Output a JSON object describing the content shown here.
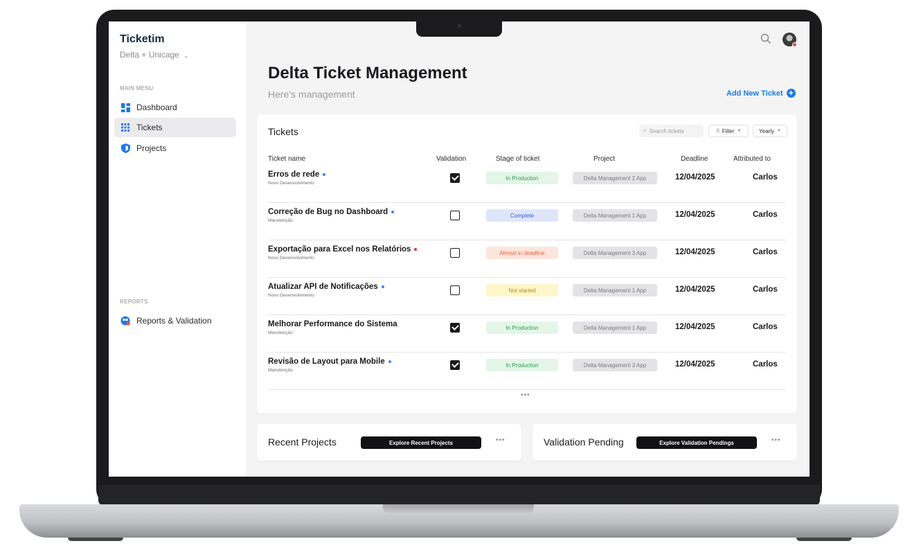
{
  "sidebar": {
    "brand": "Ticketim",
    "workspace": "Delta + Unicage",
    "main_menu_label": "MAIN MENU",
    "items": [
      {
        "label": "Dashboard",
        "icon": "dashboard-icon"
      },
      {
        "label": "Tickets",
        "icon": "grid-icon",
        "active": true
      },
      {
        "label": "Projects",
        "icon": "shield-icon"
      }
    ],
    "reports_label": "REPORTS",
    "reports_items": [
      {
        "label": "Reports & Validation",
        "icon": "reports-icon"
      }
    ]
  },
  "header": {
    "title_bold": "Delta",
    "title_rest": " Ticket Management",
    "subtitle": "Here's management",
    "add_ticket": "Add New Ticket"
  },
  "tickets": {
    "title": "Tickets",
    "search_placeholder": "Search tickets",
    "filter_label": "Filter",
    "period_label": "Yearly",
    "columns": [
      "Ticket name",
      "Validation",
      "Stage of ticket",
      "Project",
      "Deadline",
      "Attributed to"
    ],
    "rows": [
      {
        "name": "Erros de rede",
        "category": "Novo Desenvolvimento",
        "dot_color": "#3b82f6",
        "validated": true,
        "stage": "In Production",
        "project": "Delta Management 2 App",
        "deadline": "12/04/2025",
        "owner": "Carlos"
      },
      {
        "name": "Correção de Bug no Dashboard",
        "category": "Manutenção",
        "dot_color": "#3b82f6",
        "validated": false,
        "stage": "Complete",
        "project": "Delta Management 1 App",
        "deadline": "12/04/2025",
        "owner": "Carlos"
      },
      {
        "name": "Exportação para Excel nos Relatórios",
        "category": "Novo Desenvolvimento",
        "dot_color": "#ef2b2b",
        "validated": false,
        "stage": "Almost in deadline",
        "project": "Delta Management 3 App",
        "deadline": "12/04/2025",
        "owner": "Carlos"
      },
      {
        "name": "Atualizar API de Notificações",
        "category": "Novo Desenvolvimento",
        "dot_color": "#3b82f6",
        "validated": false,
        "stage": "Not started",
        "project": "Delta Management 1 App",
        "deadline": "12/04/2025",
        "owner": "Carlos"
      },
      {
        "name": "Melhorar Performance do Sistema",
        "category": "Manutenção",
        "dot_color": "",
        "validated": true,
        "stage": "In Production",
        "project": "Delta Management 1 App",
        "deadline": "12/04/2025",
        "owner": "Carlos"
      },
      {
        "name": "Revisão de Layout para Mobile",
        "category": "Manutenção",
        "dot_color": "#3b82f6",
        "validated": true,
        "stage": "In Production",
        "project": "Delta Management 3 App",
        "deadline": "12/04/2025",
        "owner": "Carlos"
      }
    ],
    "more": "•••"
  },
  "stage_colors": {
    "In Production": {
      "bg": "#e3f6e8",
      "fg": "#2e9a4c"
    },
    "Complete": {
      "bg": "#dfe6fb",
      "fg": "#3a57d8"
    },
    "Almost in deadline": {
      "bg": "#fde5dc",
      "fg": "#e5633c"
    },
    "Not started": {
      "bg": "#fdf6c9",
      "fg": "#b38a13"
    }
  },
  "recent_projects": {
    "title": "Recent Projects",
    "button": "Explore Recent Projects",
    "more": "•••"
  },
  "validation_pending": {
    "title": "Validation Pending",
    "button": "Explore Validation Pendings",
    "more": "•••"
  }
}
